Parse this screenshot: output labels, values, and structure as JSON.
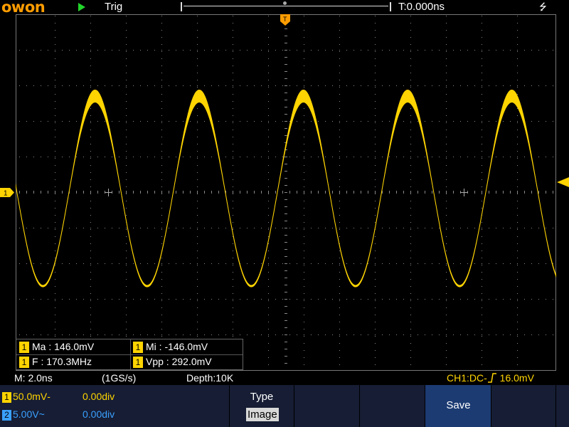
{
  "brand": "owon",
  "top": {
    "trig_label": "Trig",
    "trig_time": "T:0.000ns",
    "usb_icon": "usb-icon",
    "run_icon": "play-icon"
  },
  "measurements": {
    "max_label": "Ma : 146.0mV",
    "min_label": "Mi : -146.0mV",
    "freq_label": "F : 170.3MHz",
    "vpp_label": "Vpp : 292.0mV",
    "channel": "1"
  },
  "status": {
    "timebase": "M: 2.0ns",
    "sample_rate": "(1GS/s)",
    "depth": "Depth:10K",
    "trigger": "CH1:DC-↑ 16.0mV",
    "trigger_prefix": "CH1:DC-",
    "trigger_level": "16.0mV"
  },
  "channels": [
    {
      "id": "1",
      "scale": "50.0mV‐",
      "offset": "0.00div",
      "color": "#ffd400"
    },
    {
      "id": "2",
      "scale": "5.00V~",
      "offset": "0.00div",
      "color": "#3aa0ff"
    }
  ],
  "softkeys": {
    "type_label": "Type",
    "type_value": "Image",
    "save_label": "Save"
  },
  "markers": {
    "ch1": "1",
    "trig_pos": "T"
  },
  "colors": {
    "ch1": "#ffd400",
    "ch2": "#3aa0ff",
    "brand": "#ff9d00",
    "panel": "#161d34",
    "save_active": "#1c3b73"
  }
}
